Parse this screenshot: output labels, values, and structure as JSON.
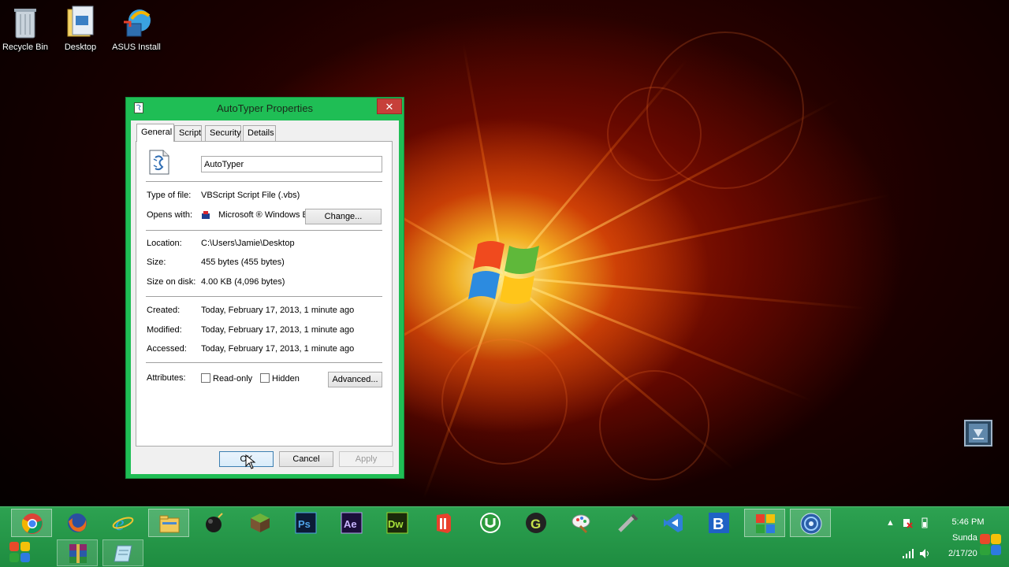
{
  "desktop": {
    "icons": [
      {
        "label": "Recycle Bin"
      },
      {
        "label": "Desktop"
      },
      {
        "label": "ASUS Install"
      }
    ]
  },
  "dialog": {
    "title": "AutoTyper Properties",
    "close_glyph": "✕",
    "tabs": [
      "General",
      "Script",
      "Security",
      "Details"
    ],
    "active_tab": "General",
    "file_name": "AutoTyper",
    "fields": {
      "type_label": "Type of file:",
      "type_value": "VBScript Script File (.vbs)",
      "opens_label": "Opens with:",
      "opens_value": "Microsoft ® Windows B",
      "change_button": "Change...",
      "location_label": "Location:",
      "location_value": "C:\\Users\\Jamie\\Desktop",
      "size_label": "Size:",
      "size_value": "455 bytes (455 bytes)",
      "size_on_disk_label": "Size on disk:",
      "size_on_disk_value": "4.00 KB (4,096 bytes)",
      "created_label": "Created:",
      "created_value": "Today, February 17, 2013, 1 minute ago",
      "modified_label": "Modified:",
      "modified_value": "Today, February 17, 2013, 1 minute ago",
      "accessed_label": "Accessed:",
      "accessed_value": "Today, February 17, 2013, 1 minute ago",
      "attributes_label": "Attributes:",
      "readonly_label": "Read-only",
      "hidden_label": "Hidden",
      "advanced_button": "Advanced..."
    },
    "buttons": {
      "ok": "OK",
      "cancel": "Cancel",
      "apply": "Apply"
    }
  },
  "taskbar": {
    "apps_row1": [
      "chrome-icon",
      "firefox-icon",
      "internet-explorer-icon",
      "file-explorer-icon",
      "bomb-icon",
      "minecraft-icon",
      "photoshop-icon",
      "after-effects-icon",
      "dreamweaver-icon",
      "office-icon",
      "utorrent-icon",
      "g-app-icon",
      "paint-icon",
      "tool-icon",
      "visual-studio-icon",
      "b-app-icon",
      "tiles-icon",
      "globe-app-icon"
    ],
    "app_labels": {
      "ps": "Ps",
      "ae": "Ae",
      "dw": "Dw",
      "b": "B",
      "g": "G"
    },
    "clock": {
      "time": "5:46 PM",
      "day": "Sunda",
      "date": "2/17/20"
    }
  },
  "colors": {
    "taskbar": "#1e8c40",
    "dialog_frame": "#1fbe55",
    "close_button": "#c7403a"
  }
}
